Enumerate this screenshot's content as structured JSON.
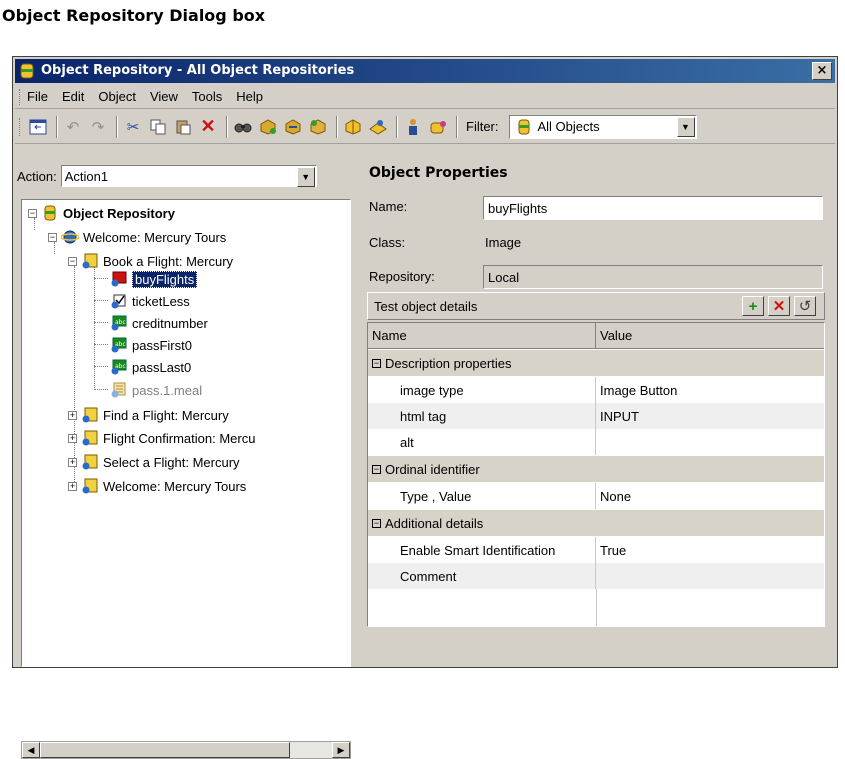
{
  "page_title": "Object Repository Dialog box",
  "window": {
    "title": "Object Repository - All Object Repositories",
    "close_label": "×"
  },
  "menu": [
    "File",
    "Edit",
    "Object",
    "View",
    "Tools",
    "Help"
  ],
  "toolbar": {
    "filter_label": "Filter:",
    "filter_value": "All Objects"
  },
  "left_panel": {
    "action_label": "Action:",
    "action_value": "Action1",
    "tree": {
      "root": "Object Repository",
      "browser": "Welcome: Mercury Tours",
      "page_open": "Book a Flight: Mercury",
      "objects": [
        "buyFlights",
        "ticketLess",
        "creditnumber",
        "passFirst0",
        "passLast0",
        "pass.1.meal"
      ],
      "pages_collapsed": [
        "Find a Flight: Mercury",
        "Flight Confirmation: Mercu",
        "Select a Flight: Mercury",
        "Welcome: Mercury Tours"
      ]
    }
  },
  "properties": {
    "section_title": "Object Properties",
    "name_label": "Name:",
    "name_value": "buyFlights",
    "class_label": "Class:",
    "class_value": "Image",
    "repository_label": "Repository:",
    "repository_value": "Local",
    "details_title": "Test object details",
    "grid": {
      "col_name": "Name",
      "col_value": "Value",
      "cat_description": "Description properties",
      "image_type_name": "image type",
      "image_type_value": "Image Button",
      "html_tag_name": "html tag",
      "html_tag_value": "INPUT",
      "alt_name": "alt",
      "cat_ordinal": "Ordinal identifier",
      "type_value_name": "Type , Value",
      "type_value_value": "None",
      "cat_additional": "Additional details",
      "smart_id_name": "Enable Smart Identification",
      "smart_id_value": "True",
      "comment_name": "Comment"
    }
  }
}
